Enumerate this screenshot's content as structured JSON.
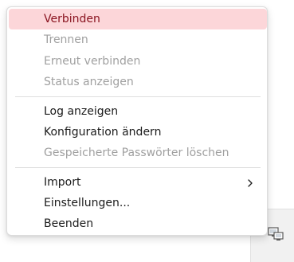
{
  "menu": {
    "group1": [
      {
        "label": "Verbinden",
        "state": "highlighted"
      },
      {
        "label": "Trennen",
        "state": "disabled"
      },
      {
        "label": "Erneut verbinden",
        "state": "disabled"
      },
      {
        "label": "Status anzeigen",
        "state": "disabled"
      }
    ],
    "group2": [
      {
        "label": "Log anzeigen",
        "state": "enabled"
      },
      {
        "label": "Konfiguration ändern",
        "state": "enabled"
      },
      {
        "label": "Gespeicherte Passwörter löschen",
        "state": "disabled"
      }
    ],
    "group3": [
      {
        "label": "Import",
        "state": "enabled",
        "icon": "chevron-right-icon"
      },
      {
        "label": "Einstellungen...",
        "state": "enabled"
      },
      {
        "label": "Beenden",
        "state": "enabled"
      }
    ]
  },
  "tray": {
    "icon": "network-computer-icon"
  },
  "colors": {
    "highlight_bg": "#fcd6d9",
    "highlight_text": "#8a1420",
    "disabled_text": "#a0a0a0",
    "enabled_text": "#1b1b1b"
  }
}
